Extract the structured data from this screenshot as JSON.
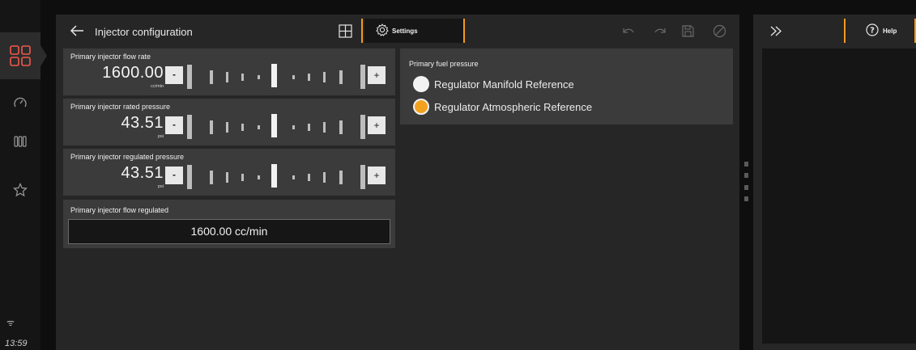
{
  "status": {
    "time": "13:59"
  },
  "nav": {
    "items": [
      {
        "name": "dashboard-grid",
        "icon": "grid-icon",
        "active": true
      },
      {
        "name": "gauge",
        "icon": "speedometer-icon"
      },
      {
        "name": "columns",
        "icon": "columns-icon"
      },
      {
        "name": "favorites",
        "icon": "star-icon"
      }
    ],
    "accent_color": "#f15a4a"
  },
  "header": {
    "title": "Injector configuration",
    "settings_tab": "Settings",
    "accent_color": "#f29a1f"
  },
  "sliders": [
    {
      "label": "Primary injector flow rate",
      "value": "1600.00",
      "unit": "cc/min",
      "minus": "-",
      "plus": "+"
    },
    {
      "label": "Primary injector rated pressure",
      "value": "43.51",
      "unit": "psi",
      "minus": "-",
      "plus": "+"
    },
    {
      "label": "Primary injector regulated pressure",
      "value": "43.51",
      "unit": "psi",
      "minus": "-",
      "plus": "+"
    }
  ],
  "flow_regulated": {
    "label": "Primary injector flow regulated",
    "value": "1600.00 cc/min"
  },
  "fuel_pressure": {
    "label": "Primary fuel pressure",
    "options": [
      {
        "label": "Regulator Manifold Reference",
        "selected": false
      },
      {
        "label": "Regulator Atmospheric Reference",
        "selected": true
      }
    ]
  },
  "right_panel": {
    "help_label": "Help"
  }
}
